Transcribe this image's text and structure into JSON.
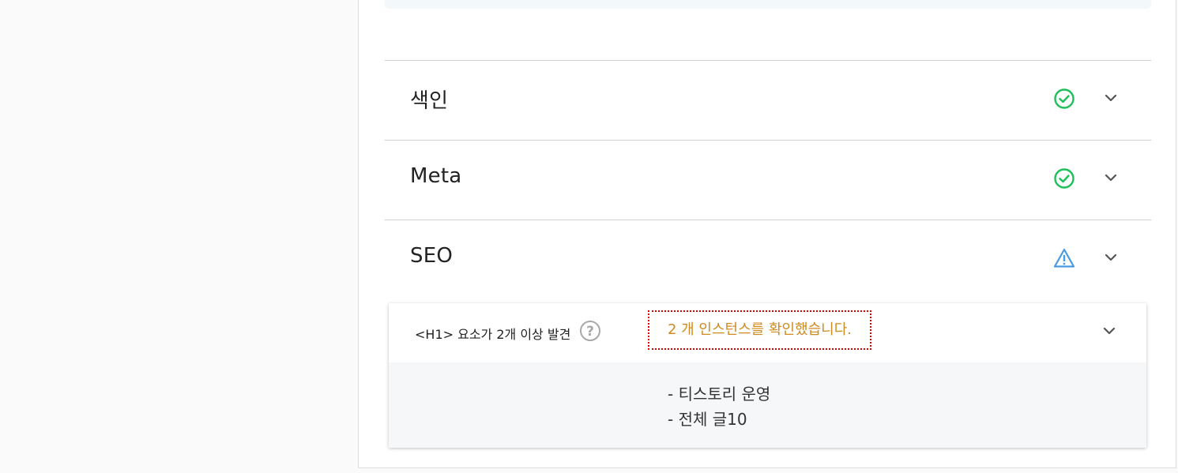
{
  "sections": [
    {
      "title": "색인",
      "status": "ok",
      "status_icon": "check-circle-icon"
    },
    {
      "title": "Meta",
      "status": "ok",
      "status_icon": "check-circle-icon"
    },
    {
      "title": "SEO",
      "status": "warning",
      "status_icon": "warning-triangle-icon"
    }
  ],
  "seo_item": {
    "label": "<H1> 요소가 2개 이상 발견",
    "instances_text": "2 개 인스턴스를 확인했습니다.",
    "details": [
      "- 티스토리 운영",
      "- 전체 글10"
    ]
  },
  "colors": {
    "ok": "#1fbf5a",
    "warning": "#4a9be0",
    "instances": "#d08a1e",
    "highlight_border": "#e00000"
  }
}
